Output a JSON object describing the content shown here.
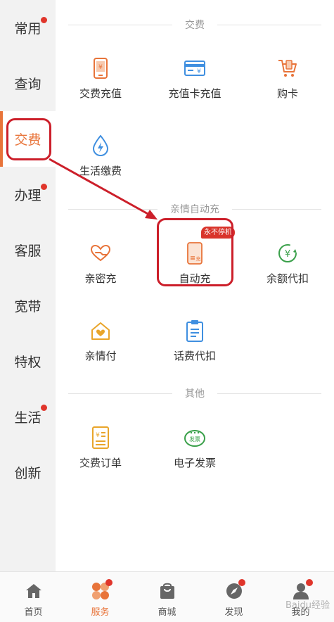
{
  "colors": {
    "accent": "#e8743a",
    "dot": "#e0352b",
    "annotation": "#cc1f2a",
    "blue": "#3f8fe0",
    "green": "#3aa04a"
  },
  "sidebar": {
    "items": [
      {
        "label": "常用",
        "dot": true
      },
      {
        "label": "查询",
        "dot": false
      },
      {
        "label": "交费",
        "dot": false,
        "active": true
      },
      {
        "label": "办理",
        "dot": true
      },
      {
        "label": "客服",
        "dot": false
      },
      {
        "label": "宽带",
        "dot": false
      },
      {
        "label": "特权",
        "dot": false
      },
      {
        "label": "生活",
        "dot": true
      },
      {
        "label": "创新",
        "dot": false
      }
    ]
  },
  "sections": {
    "pay": {
      "title": "交费",
      "items": [
        {
          "label": "交费充值",
          "icon": "phone-yen-icon"
        },
        {
          "label": "充值卡充值",
          "icon": "card-yen-icon"
        },
        {
          "label": "购卡",
          "icon": "cart-icon"
        },
        {
          "label": "生活缴费",
          "icon": "water-drop-bolt-icon"
        }
      ]
    },
    "family": {
      "title": "亲情自动充",
      "items": [
        {
          "label": "亲密充",
          "icon": "heart-hand-icon"
        },
        {
          "label": "自动充",
          "icon": "phone-auto-icon",
          "badge": "永不停机"
        },
        {
          "label": "余额代扣",
          "icon": "yen-cycle-icon"
        },
        {
          "label": "亲情付",
          "icon": "house-heart-icon"
        },
        {
          "label": "话费代扣",
          "icon": "clipboard-icon"
        }
      ]
    },
    "other": {
      "title": "其他",
      "items": [
        {
          "label": "交费订单",
          "icon": "receipt-icon"
        },
        {
          "label": "电子发票",
          "icon": "invoice-icon",
          "icon_text": "发票"
        }
      ]
    }
  },
  "bottom_nav": {
    "items": [
      {
        "label": "首页",
        "icon": "home-icon"
      },
      {
        "label": "服务",
        "icon": "service-icon",
        "active": true,
        "dot": true
      },
      {
        "label": "商城",
        "icon": "shop-bag-icon"
      },
      {
        "label": "发现",
        "icon": "compass-icon",
        "dot": true
      },
      {
        "label": "我的",
        "icon": "user-icon",
        "dot": true
      }
    ]
  },
  "watermark": "Baidu经验"
}
